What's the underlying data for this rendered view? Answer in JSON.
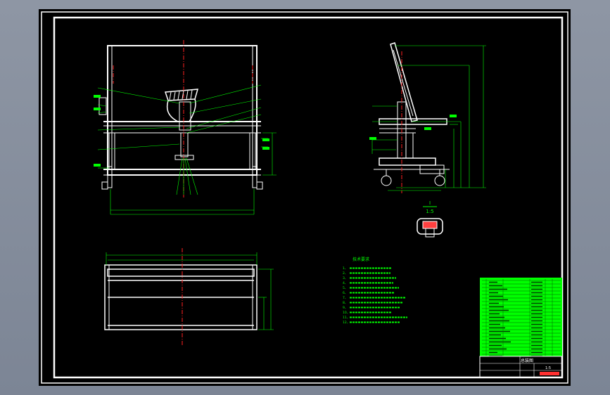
{
  "sheet": {
    "colors": {
      "background": "#000000",
      "outline": "#ffffff",
      "dimension": "#00ff00",
      "centerline": "#ff2020",
      "title_block_fill": "#00ff00",
      "viewport": "#8e96a4"
    }
  },
  "views": {
    "front": {
      "name": "front-elevation"
    },
    "side": {
      "name": "side-elevation"
    },
    "detail": {
      "name": "section-detail",
      "label_top": "I",
      "label_scale": "1:5"
    },
    "plan": {
      "name": "plan-view"
    }
  },
  "notes": {
    "title": "技术要求",
    "items": [
      "1、",
      "2、",
      "3、",
      "4、",
      "5、",
      "6、",
      "7、",
      "8、",
      "9、",
      "10、",
      "11、",
      "12、"
    ]
  },
  "title_block": {
    "drawing_title": "总装图",
    "scale_text": "1:5"
  }
}
